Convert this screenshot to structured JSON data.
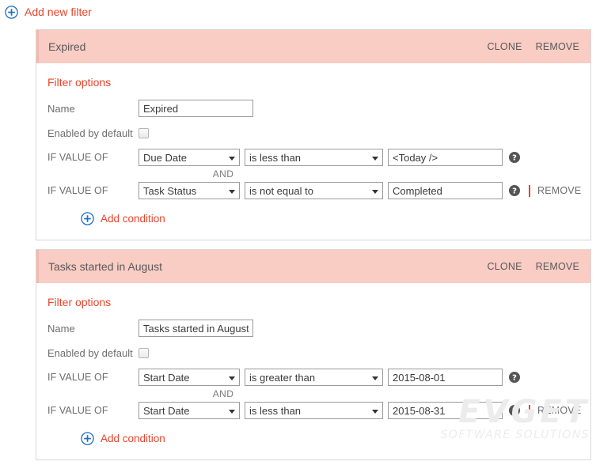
{
  "toolbar": {
    "add_new_filter_label": "Add new filter",
    "add_icon": "circle-plus-icon"
  },
  "colors": {
    "accent_red": "#e8452c",
    "header_pink": "#f9ccc4",
    "header_pink_border": "#f4b9ae",
    "label_gray": "#6d6d6d",
    "icon_blue": "#1f6fc4"
  },
  "panel_actions": {
    "clone_label": "CLONE",
    "remove_label": "REMOVE"
  },
  "labels": {
    "filter_options": "Filter options",
    "name": "Name",
    "enabled_by_default": "Enabled by default",
    "if_value_of": "IF VALUE OF",
    "and": "AND",
    "add_condition": "Add condition",
    "remove_condition": "REMOVE",
    "help_icon": "help-question-icon",
    "add_icon": "circle-plus-icon"
  },
  "filters": [
    {
      "title": "Expired",
      "name_value": "Expired",
      "enabled_by_default": false,
      "conditions": [
        {
          "field": "Due Date",
          "operator": "is less than",
          "value": "<Today />",
          "has_remove": false
        },
        {
          "field": "Task Status",
          "operator": "is not equal to",
          "value": "Completed",
          "has_remove": true
        }
      ]
    },
    {
      "title": "Tasks started in August",
      "name_value": "Tasks started in August",
      "enabled_by_default": false,
      "conditions": [
        {
          "field": "Start Date",
          "operator": "is greater than",
          "value": "2015-08-01",
          "has_remove": false
        },
        {
          "field": "Start Date",
          "operator": "is less than",
          "value": "2015-08-31",
          "has_remove": true
        }
      ]
    }
  ],
  "watermark": {
    "main": "EVGET",
    "sub": "SOFTWARE SOLUTIONS"
  }
}
